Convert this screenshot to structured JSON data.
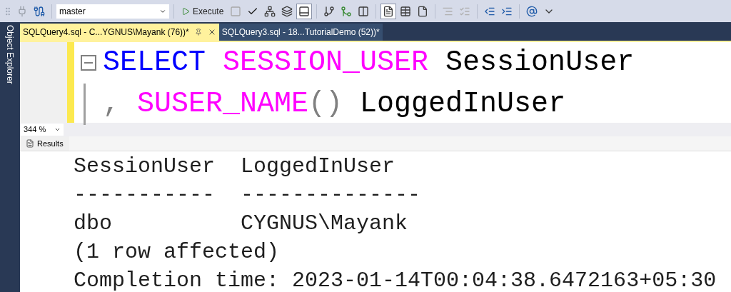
{
  "toolbar": {
    "database": "master",
    "execute_label": "Execute"
  },
  "sidebar": {
    "label": "Object Explorer"
  },
  "tabs": [
    {
      "label": "SQLQuery4.sql - C...YGNUS\\Mayank (76))*",
      "selected": true
    },
    {
      "label": "SQLQuery3.sql - 18...TutorialDemo (52))*",
      "selected": false
    }
  ],
  "editor": {
    "lines": [
      {
        "fold": true,
        "tokens": [
          {
            "kind": "keyword",
            "text": "SELECT"
          },
          {
            "kind": "function",
            "text": " SESSION_USER"
          },
          {
            "kind": "plain",
            "text": " SessionUser"
          }
        ]
      },
      {
        "fold": false,
        "tokens": [
          {
            "kind": "operator",
            "text": ","
          },
          {
            "kind": "function",
            "text": " SUSER_NAME"
          },
          {
            "kind": "operator",
            "text": "()"
          },
          {
            "kind": "plain",
            "text": " LoggedInUser"
          }
        ]
      }
    ]
  },
  "zoom": "344 %",
  "results_tab": "Results",
  "results": [
    "SessionUser  LoggedInUser",
    "-----------  --------------",
    "dbo          CYGNUS\\Mayank",
    "(1 row affected)",
    "Completion time: 2023-01-14T00:04:38.6472163+05:30"
  ]
}
